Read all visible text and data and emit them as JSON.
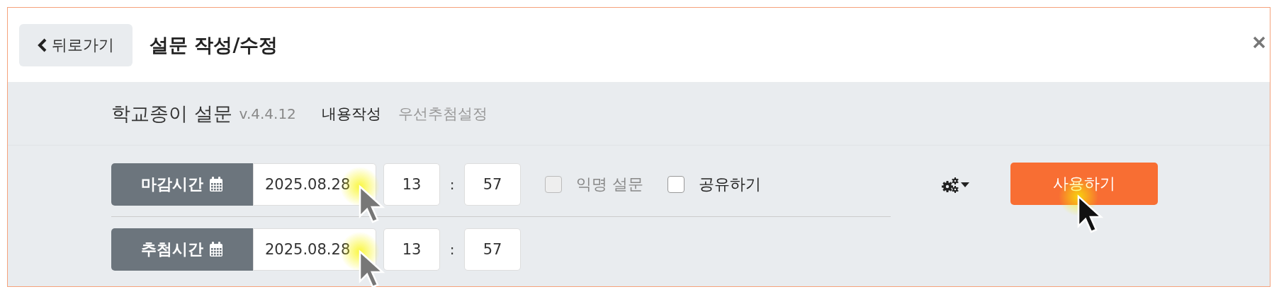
{
  "header": {
    "back_button": "뒤로가기",
    "title": "설문 작성/수정"
  },
  "app": {
    "name": "학교종이 설문",
    "version": "v.4.4.12"
  },
  "tabs": [
    {
      "label": "내용작성",
      "selected": true
    },
    {
      "label": "우선추첨설정",
      "selected": false
    }
  ],
  "time_rows": [
    {
      "label": "마감시간",
      "date": "2025.08.28",
      "hour": "13",
      "minute": "57",
      "separator": ":"
    },
    {
      "label": "추첨시간",
      "date": "2025.08.28",
      "hour": "13",
      "minute": "57",
      "separator": ":"
    }
  ],
  "options": [
    {
      "label": "익명 설문",
      "checked": false,
      "disabled": true
    },
    {
      "label": "공유하기",
      "checked": false,
      "disabled": false
    }
  ],
  "submit_button": "사용하기"
}
